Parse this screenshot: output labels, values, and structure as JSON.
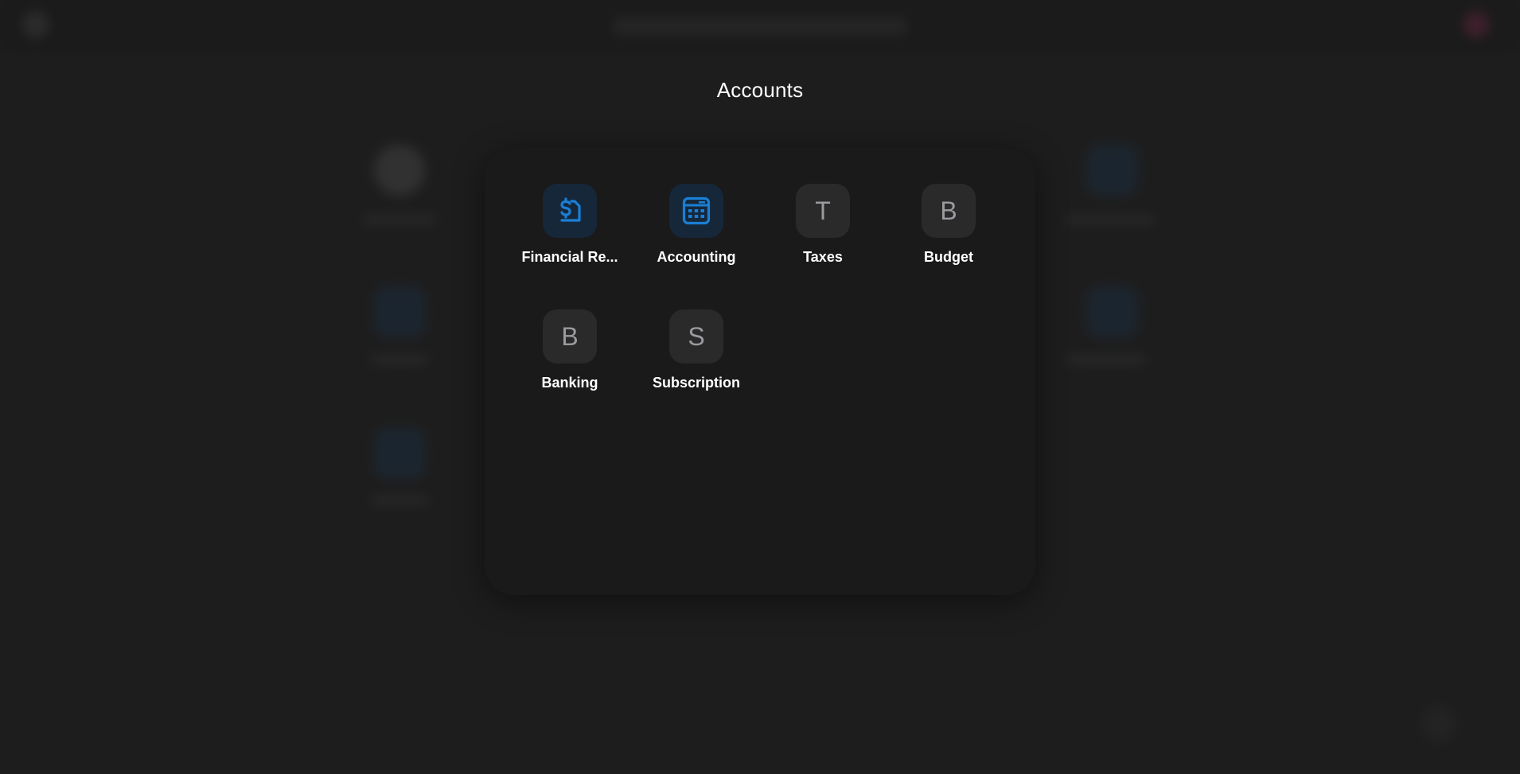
{
  "folder": {
    "title": "Accounts"
  },
  "apps": [
    {
      "label": "Financial Re...",
      "icon": "financial-report-icon",
      "letter": ""
    },
    {
      "label": "Accounting",
      "icon": "calculator-icon",
      "letter": ""
    },
    {
      "label": "Taxes",
      "icon": "letter-t-icon",
      "letter": "T"
    },
    {
      "label": "Budget",
      "icon": "letter-b-icon",
      "letter": "B"
    },
    {
      "label": "Banking",
      "icon": "letter-b-icon",
      "letter": "B"
    },
    {
      "label": "Subscription",
      "icon": "letter-s-icon",
      "letter": "S"
    }
  ],
  "colors": {
    "accent_blue": "#1a7fd6",
    "icon_tile_blue": "#16273a",
    "icon_tile_gray": "#2a2a2a",
    "panel_bg": "#1a1a1a",
    "page_bg": "#232323"
  }
}
